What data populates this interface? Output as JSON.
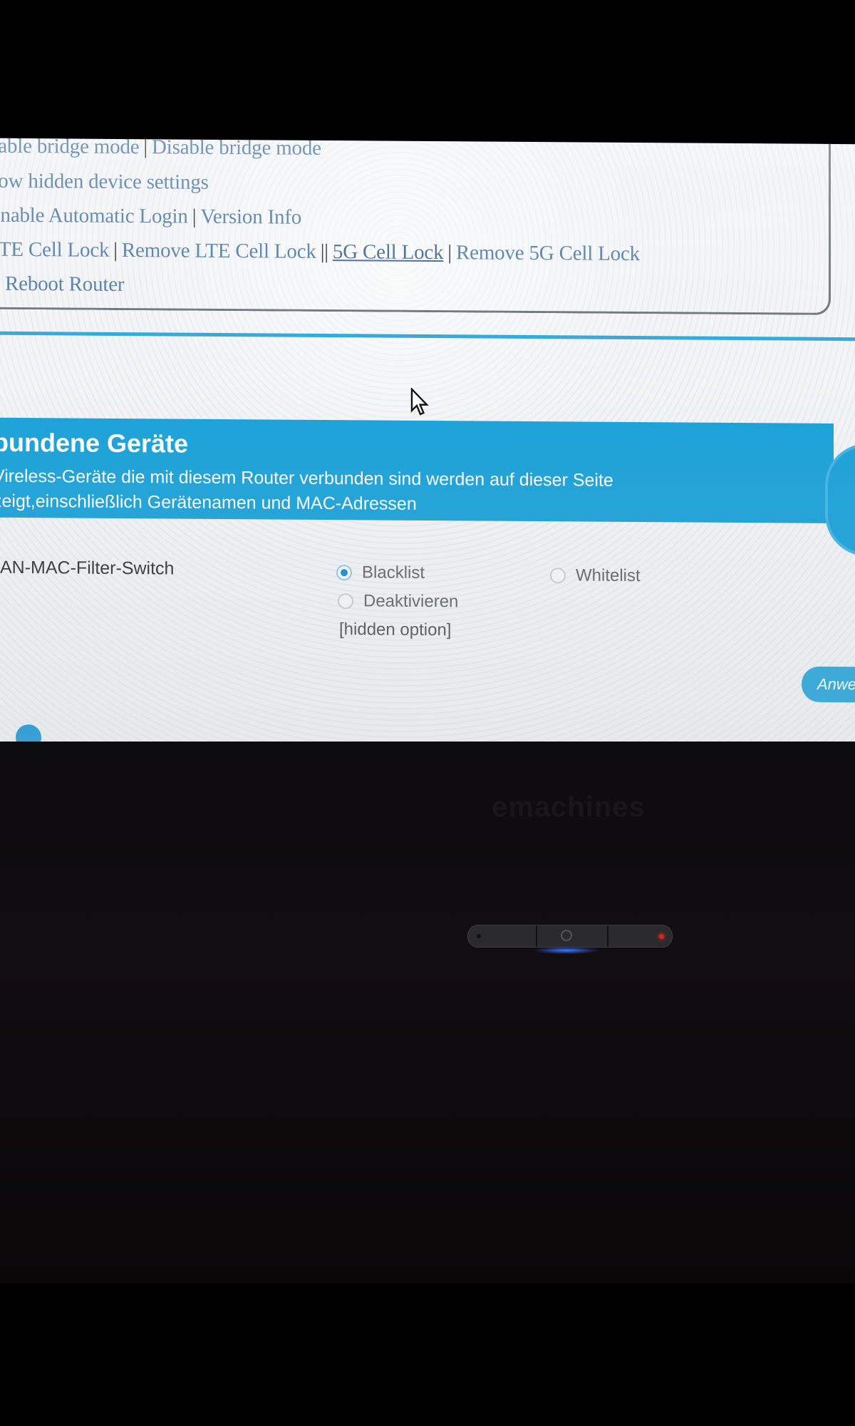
{
  "router_page": {
    "links": {
      "line1": [
        "nable bridge mode",
        "Disable bridge mode"
      ],
      "line2": [
        "how hidden device settings"
      ],
      "line3": [
        "Enable Automatic Login",
        "Version Info"
      ],
      "line4": [
        "LTE Cell Lock",
        "Remove LTE Cell Lock",
        "5G Cell Lock",
        "Remove 5G Cell Lock"
      ],
      "line5": [
        "Reboot Router"
      ],
      "separator": "|",
      "double_separator": "||"
    },
    "banner": {
      "title": "bundene Geräte",
      "desc_line1": "Vireless-Geräte die mit diesem Router verbunden sind werden auf dieser Seite",
      "desc_line2": "zeigt,einschließlich Gerätenamen und MAC-Adressen"
    },
    "filter": {
      "label": "AN-MAC-Filter-Switch",
      "options": [
        {
          "label": "Blacklist",
          "selected": true
        },
        {
          "label": "Whitelist",
          "selected": false
        },
        {
          "label": "Deaktivieren",
          "selected": false
        }
      ],
      "hidden_option": "[hidden option]"
    },
    "apply_button": "Anwe"
  },
  "laptop": {
    "brand": "emachines"
  },
  "colors": {
    "accent": "#1ca2d8",
    "link": "#4a76a3",
    "led_red": "#e0201c"
  }
}
